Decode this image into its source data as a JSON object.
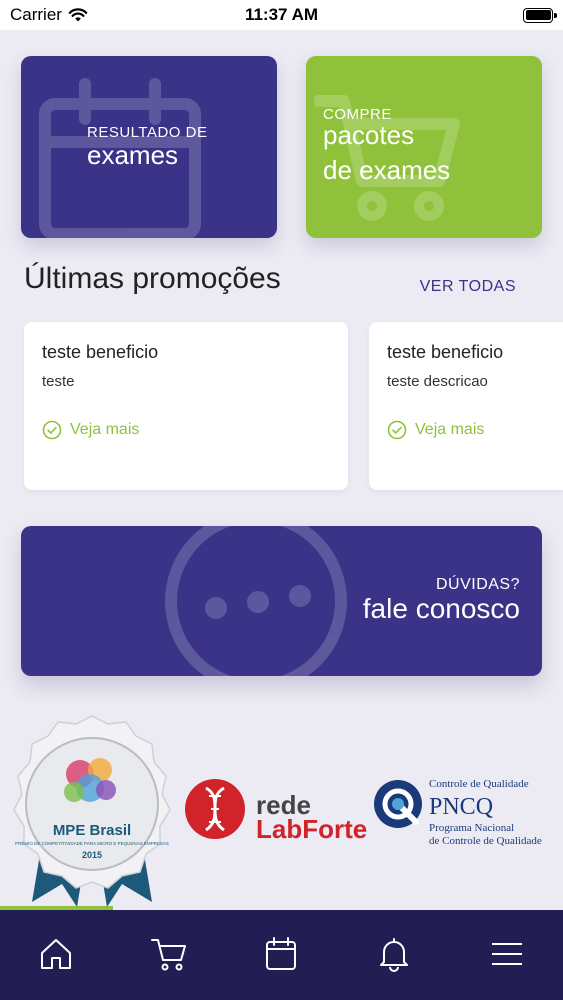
{
  "status_bar": {
    "carrier": "Carrier",
    "time": "11:37 AM"
  },
  "cards": {
    "results": {
      "small": "RESULTADO DE",
      "big": "exames"
    },
    "packages": {
      "small": "COMPRE",
      "big_line1": "pacotes",
      "big_line2": "de exames"
    }
  },
  "promotions": {
    "title": "Últimas promoções",
    "see_all": "VER TODAS",
    "items": [
      {
        "title": "teste beneficio",
        "description": "teste",
        "link": "Veja mais"
      },
      {
        "title": "teste beneficio",
        "description": "teste descricao",
        "link": "Veja mais"
      }
    ]
  },
  "contact": {
    "small": "DÚVIDAS?",
    "big": "fale conosco"
  },
  "logos": {
    "mpe": {
      "title": "MPE Brasil",
      "subtitle": "PRÊMIO DE COMPETITIVIDADE PARA MICRO E PEQUENAS EMPRESAS",
      "year": "2015"
    },
    "labforte": {
      "line1": "rede",
      "line2": "LabForte"
    },
    "pncq": {
      "top": "Controle de Qualidade",
      "main": "PNCQ",
      "sub1": "Programa Nacional",
      "sub2": "de Controle de Qualidade"
    }
  },
  "nav": {
    "progress": 0.2,
    "items": [
      "home-icon",
      "cart-icon",
      "calendar-icon",
      "bell-icon",
      "menu-icon"
    ]
  },
  "colors": {
    "primary": "#3a3388",
    "accent": "#8fc23a",
    "nav_bg": "#221d52",
    "background": "#ecebf3",
    "labforte_red": "#d0232a",
    "pncq_blue": "#1b3a7a"
  }
}
